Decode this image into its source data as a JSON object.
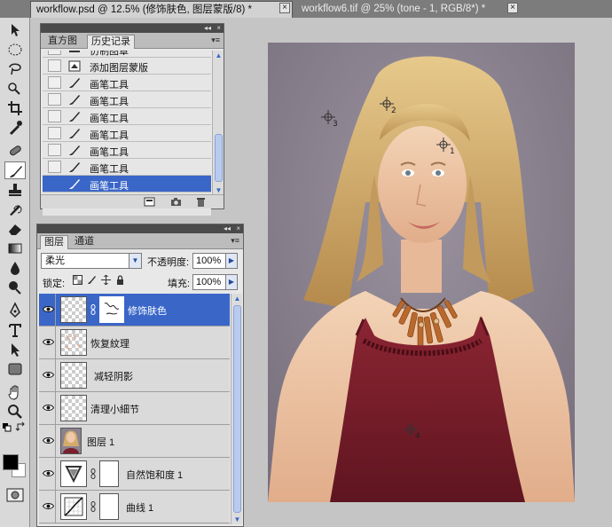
{
  "document_tabs": [
    {
      "label": "workflow.psd @ 12.5% (修饰肤色, 图层蒙版/8) *",
      "active": true
    },
    {
      "label": "workflow6.tif @ 25% (tone - 1, RGB/8*) *",
      "active": false
    }
  ],
  "tab_close_glyph": "×",
  "history_panel": {
    "tabs": [
      "直方图",
      "历史记录"
    ],
    "active_tab": "历史记录",
    "items": [
      {
        "label": "仿制图章",
        "icon": "stamp-icon"
      },
      {
        "label": "添加图层蒙版",
        "icon": "layer-mask-icon"
      },
      {
        "label": "画笔工具",
        "icon": "brush-icon"
      },
      {
        "label": "画笔工具",
        "icon": "brush-icon"
      },
      {
        "label": "画笔工具",
        "icon": "brush-icon"
      },
      {
        "label": "画笔工具",
        "icon": "brush-icon"
      },
      {
        "label": "画笔工具",
        "icon": "brush-icon"
      },
      {
        "label": "画笔工具",
        "icon": "brush-icon"
      },
      {
        "label": "画笔工具",
        "icon": "brush-icon",
        "selected": true
      }
    ]
  },
  "layers_panel": {
    "tabs": [
      "图层",
      "通道"
    ],
    "active_tab": "图层",
    "blend_mode": "柔光",
    "opacity_label": "不透明度:",
    "opacity_value": "100%",
    "lock_label": "锁定:",
    "fill_label": "填充:",
    "fill_value": "100%",
    "layers": [
      {
        "name": "修饰肤色",
        "thumb": "checker",
        "mask": true,
        "selected": true
      },
      {
        "name": "恢复紋理",
        "thumb": "checker"
      },
      {
        "name": "减轻阴影",
        "thumb": "checker"
      },
      {
        "name": "清理小細节",
        "thumb": "checker"
      },
      {
        "name": "图层 1",
        "thumb": "photo"
      },
      {
        "name": "自然饱和度 1",
        "thumb": "vibrance-adjustment",
        "mask": true
      },
      {
        "name": "曲线 1",
        "thumb": "curves-adjustment",
        "mask": true
      }
    ]
  },
  "color_samplers": [
    "1",
    "2",
    "3",
    "4"
  ],
  "colors": {
    "selection": "#3a66c8",
    "photo_background": "#8b8290",
    "dress": "#7a1f2c",
    "hair": "#d9b173"
  }
}
